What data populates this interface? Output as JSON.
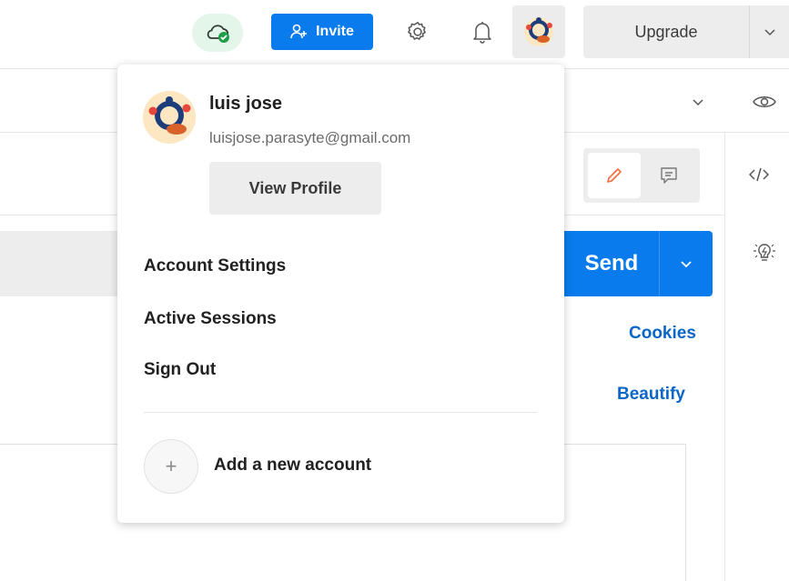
{
  "topbar": {
    "invite_label": "Invite",
    "upgrade_label": "Upgrade",
    "icons": [
      "cloud-sync-icon",
      "invite-user-icon",
      "gear-icon",
      "bell-icon",
      "avatar",
      "chevron-down-icon"
    ]
  },
  "workspace": {
    "send_label": "Send",
    "cookies_link": "Cookies",
    "beautify_link": "Beautify",
    "icons": [
      "eye-icon",
      "code-icon",
      "lightbulb-icon",
      "pencil-icon",
      "comment-icon"
    ]
  },
  "account_menu": {
    "user_name": "luis jose",
    "user_email": "luisjose.parasyte@gmail.com",
    "view_profile_label": "View Profile",
    "items": [
      {
        "label": "Account Settings"
      },
      {
        "label": "Active Sessions"
      },
      {
        "label": "Sign Out"
      }
    ],
    "add_account_label": "Add a new account",
    "add_symbol": "+"
  },
  "colors": {
    "accent_blue": "#097bed",
    "link_blue": "#0b66c8",
    "sync_green": "#1f9e4a",
    "pencil_orange": "#f26b3a"
  }
}
